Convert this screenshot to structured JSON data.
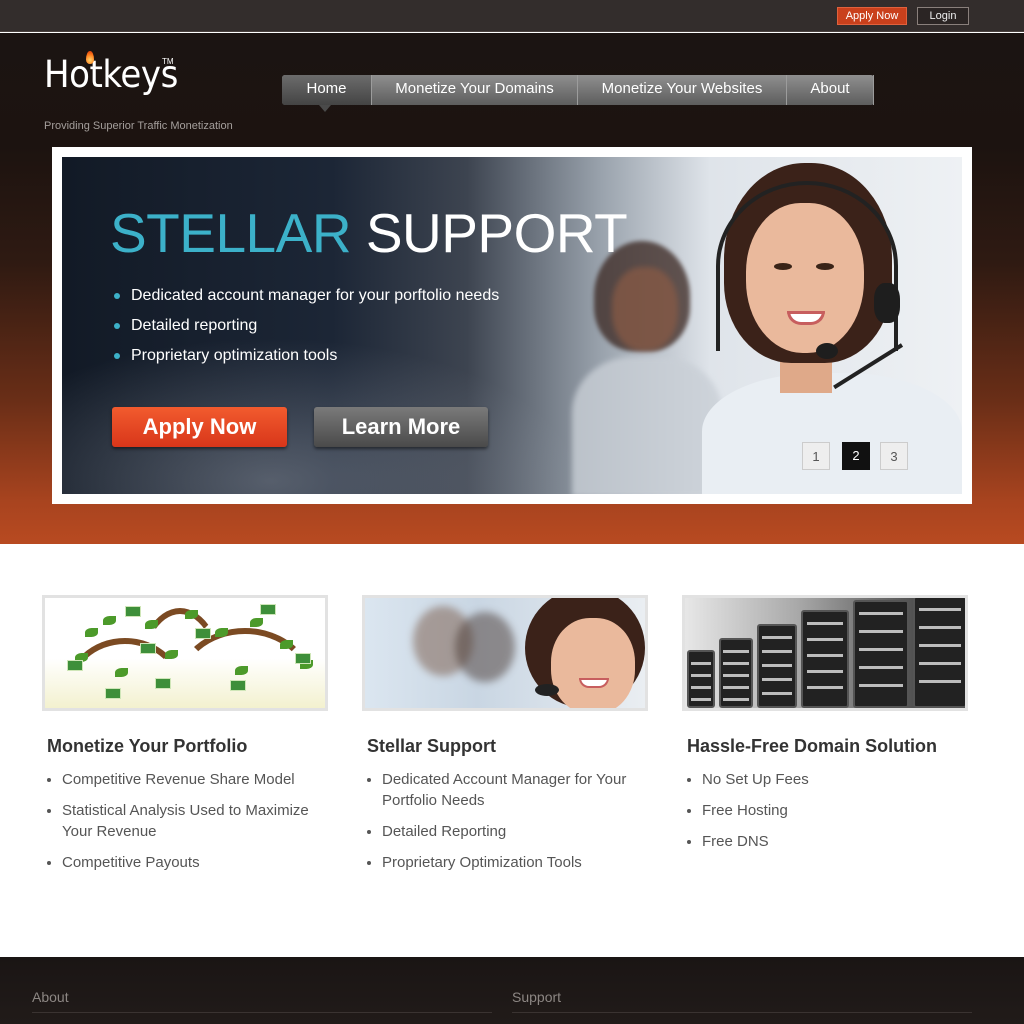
{
  "topbar": {
    "apply_label": "Apply Now",
    "login_label": "Login"
  },
  "brand": {
    "logo_text": "Hotkeys",
    "trademark": "TM",
    "tagline": "Providing Superior Traffic Monetization"
  },
  "nav": {
    "items": [
      {
        "label": "Home",
        "active": true
      },
      {
        "label": "Monetize Your Domains",
        "active": false
      },
      {
        "label": "Monetize Your Websites",
        "active": false
      },
      {
        "label": "About",
        "active": false
      }
    ]
  },
  "slider": {
    "title_accent": "STELLAR",
    "title_rest": "SUPPORT",
    "bullets": [
      "Dedicated account manager for your porftolio needs",
      "Detailed reporting",
      "Proprietary optimization tools"
    ],
    "apply_label": "Apply Now",
    "learn_label": "Learn More",
    "pages": [
      "1",
      "2",
      "3"
    ],
    "active_page": "2"
  },
  "features": [
    {
      "title": "Monetize Your Portfolio",
      "items": [
        "Competitive Revenue Share Model",
        "Statistical Analysis Used to Maximize Your Revenue",
        "Competitive Payouts"
      ]
    },
    {
      "title": "Stellar Support",
      "items": [
        "Dedicated Account Manager for Your Portfolio Needs",
        "Detailed Reporting",
        "Proprietary Optimization Tools"
      ]
    },
    {
      "title": "Hassle-Free Domain Solution",
      "items": [
        "No Set Up Fees",
        "Free Hosting",
        "Free DNS"
      ]
    }
  ],
  "footer": {
    "col1_heading": "About",
    "col2_heading": "Support"
  },
  "colors": {
    "accent_teal": "#3cb1c9",
    "cta_orange": "#d8361a",
    "hero_bottom": "#b84a21"
  }
}
